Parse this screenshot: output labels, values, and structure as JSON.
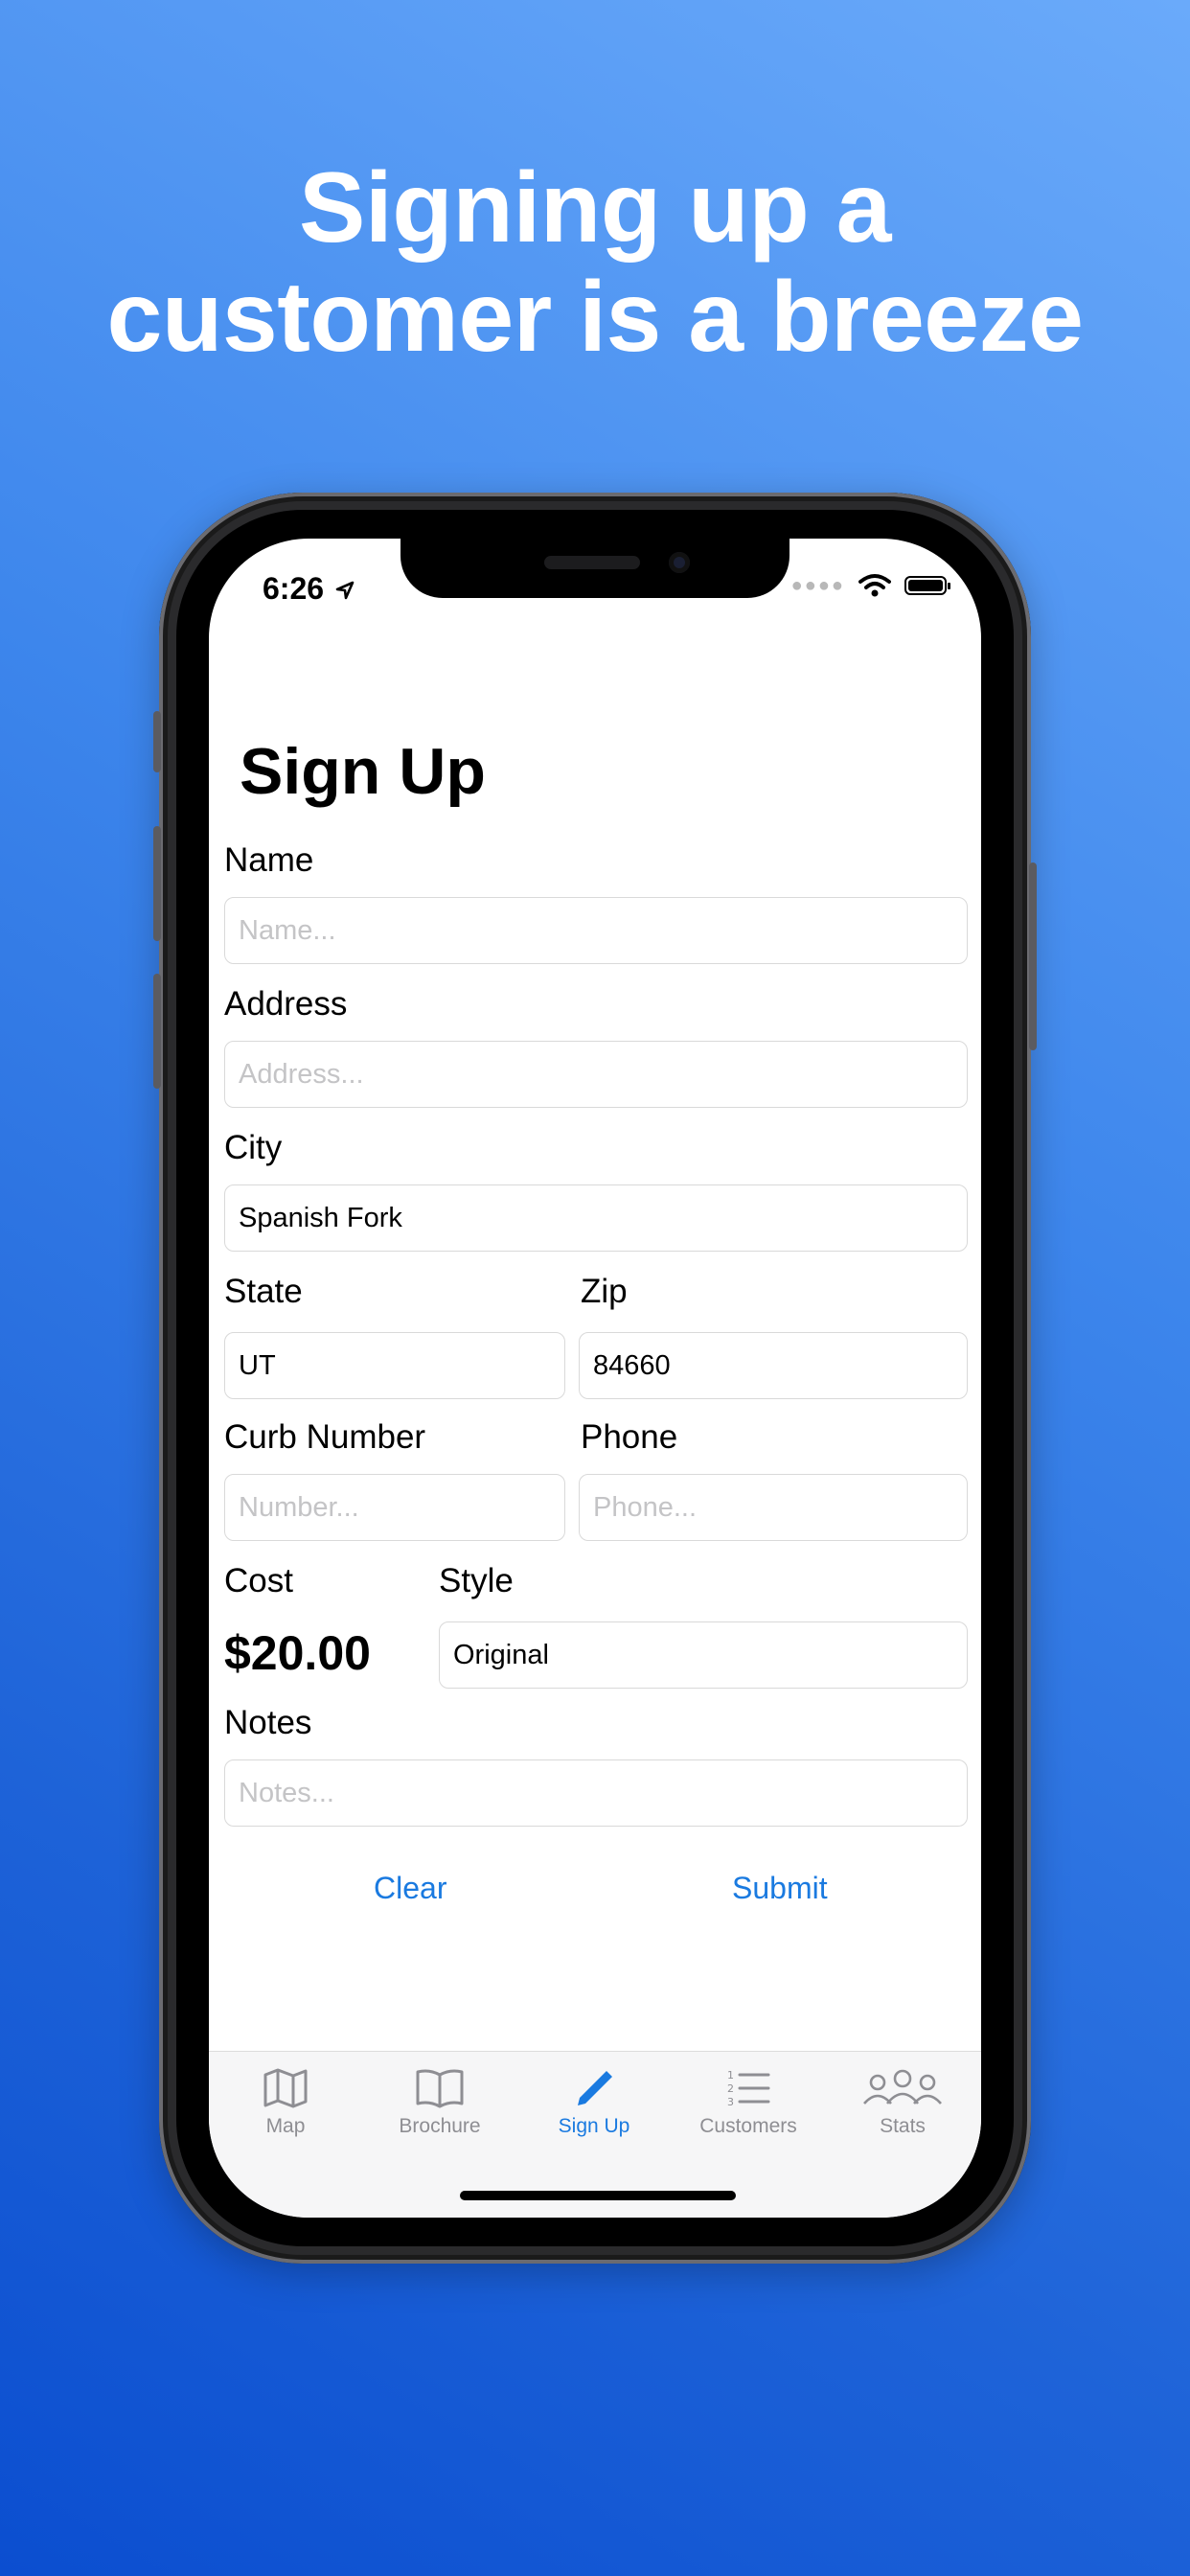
{
  "headline": {
    "line1": "Signing up a",
    "line2": "customer is a breeze"
  },
  "status_bar": {
    "time": "6:26"
  },
  "screen": {
    "title": "Sign Up",
    "name": {
      "label": "Name",
      "placeholder": "Name..."
    },
    "address": {
      "label": "Address",
      "placeholder": "Address..."
    },
    "city": {
      "label": "City",
      "value": "Spanish Fork"
    },
    "state": {
      "label": "State",
      "value": "UT"
    },
    "zip": {
      "label": "Zip",
      "value": "84660"
    },
    "curb_number": {
      "label": "Curb Number",
      "placeholder": "Number..."
    },
    "phone": {
      "label": "Phone",
      "placeholder": "Phone..."
    },
    "cost": {
      "label": "Cost",
      "value": "$20.00"
    },
    "style": {
      "label": "Style",
      "value": "Original"
    },
    "notes": {
      "label": "Notes",
      "placeholder": "Notes..."
    },
    "clear_label": "Clear",
    "submit_label": "Submit"
  },
  "tabbar": {
    "items": [
      {
        "label": "Map",
        "icon": "map-icon",
        "active": false
      },
      {
        "label": "Brochure",
        "icon": "book-icon",
        "active": false
      },
      {
        "label": "Sign Up",
        "icon": "pencil-icon",
        "active": true
      },
      {
        "label": "Customers",
        "icon": "numbered-list-icon",
        "active": false
      },
      {
        "label": "Stats",
        "icon": "people-icon",
        "active": false
      }
    ]
  },
  "colors": {
    "accent": "#1a7ae0",
    "background_top": "#6aaafa",
    "background_bottom": "#0b4ed0",
    "inactive": "#8e8e93"
  }
}
